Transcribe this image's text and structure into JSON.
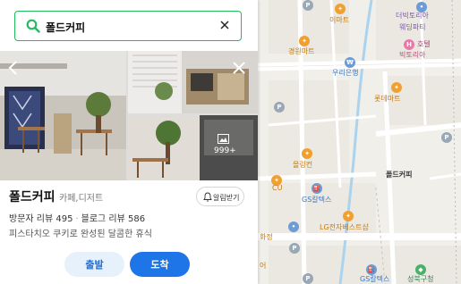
{
  "search": {
    "query": "폴드커피",
    "search_icon": "search-icon",
    "clear_icon": "close-icon"
  },
  "photos": {
    "count": "999+",
    "prev_icon": "chevron-left-icon",
    "close_icon": "close-icon"
  },
  "place": {
    "name": "폴드커피",
    "category": "카페,디저트",
    "alarm_label": "알림받기",
    "visitor_reviews": "방문자 리뷰 495",
    "blog_reviews": "블로그 리뷰 586",
    "description": "피스타치오 쿠키로 완성된 달콤한 휴식",
    "depart_label": "출발",
    "arrive_label": "도착"
  },
  "map": {
    "marker_label": "폴드커피",
    "pois": [
      {
        "label": "이마트",
        "color": "orange"
      },
      {
        "label": "더빅토리아",
        "color": "purple"
      },
      {
        "label": "웨딩파티",
        "color": "purple"
      },
      {
        "label": "호텔",
        "color": "pink"
      },
      {
        "label": "빅토리아",
        "color": "pink"
      },
      {
        "label": "경원마트",
        "color": "orange"
      },
      {
        "label": "우리은행",
        "color": "blue"
      },
      {
        "label": "롯데마트",
        "color": "orange"
      },
      {
        "label": "몰링컨",
        "color": "orange"
      },
      {
        "label": "CU",
        "color": "orange"
      },
      {
        "label": "GS칼텍스",
        "color": "blue"
      },
      {
        "label": "LG전자베스트샵",
        "color": "orange"
      },
      {
        "label": "GS칼텍스",
        "color": "blue"
      },
      {
        "label": "성북구청",
        "color": "green"
      },
      {
        "label": "화정",
        "color": "orange"
      },
      {
        "label": "어",
        "color": "orange"
      }
    ],
    "colors": {
      "accent": "#1fbe5d",
      "marker": "#f0522d",
      "arrive": "#1e75e8"
    }
  }
}
